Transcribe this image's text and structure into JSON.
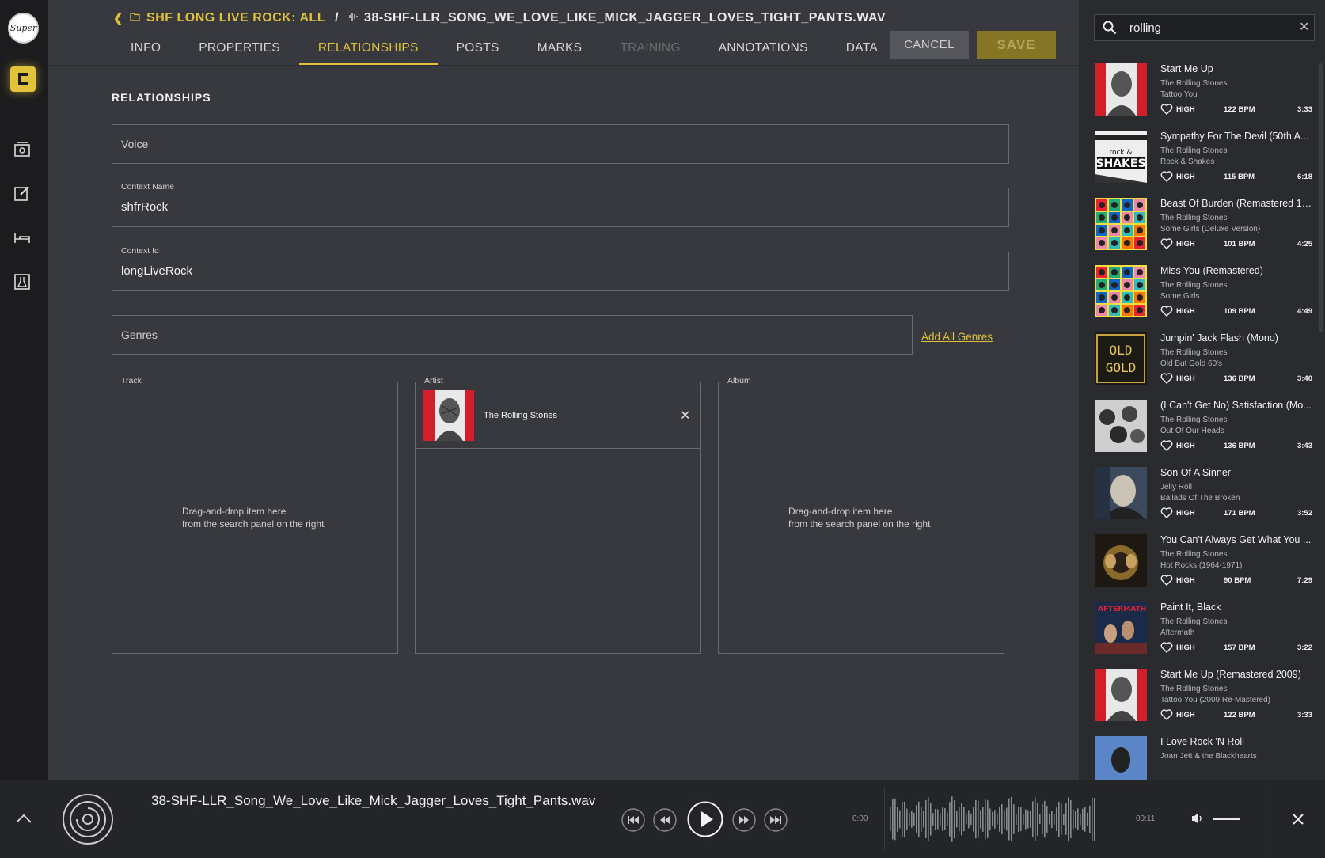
{
  "breadcrumb": {
    "back_icon": "chevron-left-icon",
    "folder_icon": "folder-icon",
    "crumb": "SHF LONG LIVE ROCK: ALL",
    "separator": "/",
    "file_icon": "audio-wave-icon",
    "file": "38-SHF-LLR_SONG_WE_LOVE_LIKE_MICK_JAGGER_LOVES_TIGHT_PANTS.WAV"
  },
  "tabs": [
    {
      "label": "INFO",
      "state": "normal"
    },
    {
      "label": "PROPERTIES",
      "state": "normal"
    },
    {
      "label": "RELATIONSHIPS",
      "state": "active"
    },
    {
      "label": "POSTS",
      "state": "normal"
    },
    {
      "label": "MARKS",
      "state": "normal"
    },
    {
      "label": "TRAINING",
      "state": "disabled"
    },
    {
      "label": "ANNOTATIONS",
      "state": "normal"
    },
    {
      "label": "DATA",
      "state": "normal"
    }
  ],
  "actions": {
    "cancel": "CANCEL",
    "save": "SAVE"
  },
  "section_title": "RELATIONSHIPS",
  "fields": {
    "voice": {
      "placeholder": "Voice"
    },
    "context_name": {
      "label": "Context Name",
      "value": "shfrRock"
    },
    "context_id": {
      "label": "Context Id",
      "value": "longLiveRock"
    },
    "genres": {
      "placeholder": "Genres"
    },
    "add_all_genres": "Add All Genres"
  },
  "dropzones": {
    "track": {
      "label": "Track",
      "hint1": "Drag-and-drop item here",
      "hint2": "from the search panel on the right"
    },
    "artist": {
      "label": "Artist",
      "item": "The Rolling Stones",
      "remove_icon": "close-icon"
    },
    "album": {
      "label": "Album",
      "hint1": "Drag-and-drop item here",
      "hint2": "from the search panel on the right"
    }
  },
  "search": {
    "query": "rolling",
    "search_icon": "search-icon",
    "clear_icon": "close-icon"
  },
  "results": [
    {
      "title": "Start Me Up",
      "artist": "The Rolling Stones",
      "album": "Tattoo You",
      "energy": "HIGH",
      "bpm": "122 BPM",
      "duration": "3:33",
      "art": "red"
    },
    {
      "title": "Sympathy For The Devil (50th A...",
      "artist": "The Rolling Stones",
      "album": "Rock & Shakes",
      "energy": "HIGH",
      "bpm": "115 BPM",
      "duration": "6:18",
      "art": "shakes"
    },
    {
      "title": "Beast Of Burden (Remastered 19...",
      "artist": "The Rolling Stones",
      "album": "Some Girls (Deluxe Version)",
      "energy": "HIGH",
      "bpm": "101 BPM",
      "duration": "4:25",
      "art": "grid"
    },
    {
      "title": "Miss You (Remastered)",
      "artist": "The Rolling Stones",
      "album": "Some Girls",
      "energy": "HIGH",
      "bpm": "109 BPM",
      "duration": "4:49",
      "art": "grid"
    },
    {
      "title": "Jumpin' Jack Flash (Mono)",
      "artist": "The Rolling Stones",
      "album": "Old But Gold 60's",
      "energy": "HIGH",
      "bpm": "136 BPM",
      "duration": "3:40",
      "art": "gold"
    },
    {
      "title": "(I Can't Get No) Satisfaction (Mo...",
      "artist": "The Rolling Stones",
      "album": "Out Of Our Heads",
      "energy": "HIGH",
      "bpm": "136 BPM",
      "duration": "3:43",
      "art": "band"
    },
    {
      "title": "Son Of A Sinner",
      "artist": "Jelly Roll",
      "album": "Ballads Of The Broken",
      "energy": "HIGH",
      "bpm": "171 BPM",
      "duration": "3:52",
      "art": "blue"
    },
    {
      "title": "You Can't Always Get What You ...",
      "artist": "The Rolling Stones",
      "album": "Hot Rocks (1964-1971)",
      "energy": "HIGH",
      "bpm": "90 BPM",
      "duration": "7:29",
      "art": "dark"
    },
    {
      "title": "Paint It, Black",
      "artist": "The Rolling Stones",
      "album": "Aftermath",
      "energy": "HIGH",
      "bpm": "157 BPM",
      "duration": "3:22",
      "art": "aftermath"
    },
    {
      "title": "Start Me Up (Remastered 2009)",
      "artist": "The Rolling Stones",
      "album": "Tattoo You (2009 Re-Mastered)",
      "energy": "HIGH",
      "bpm": "122 BPM",
      "duration": "3:33",
      "art": "red"
    },
    {
      "title": "I Love Rock 'N Roll",
      "artist": "Joan Jett & the Blackhearts",
      "album": "",
      "energy": "",
      "bpm": "",
      "duration": "",
      "art": "jett"
    }
  ],
  "player": {
    "title": "38-SHF-LLR_Song_We_Love_Like_Mick_Jagger_Loves_Tight_Pants.wav",
    "elapsed": "0:00",
    "total": "00:11"
  },
  "colors": {
    "accent": "#e0c33a",
    "background": "#38393e",
    "panel": "#2a2b2f",
    "player": "#242528"
  }
}
